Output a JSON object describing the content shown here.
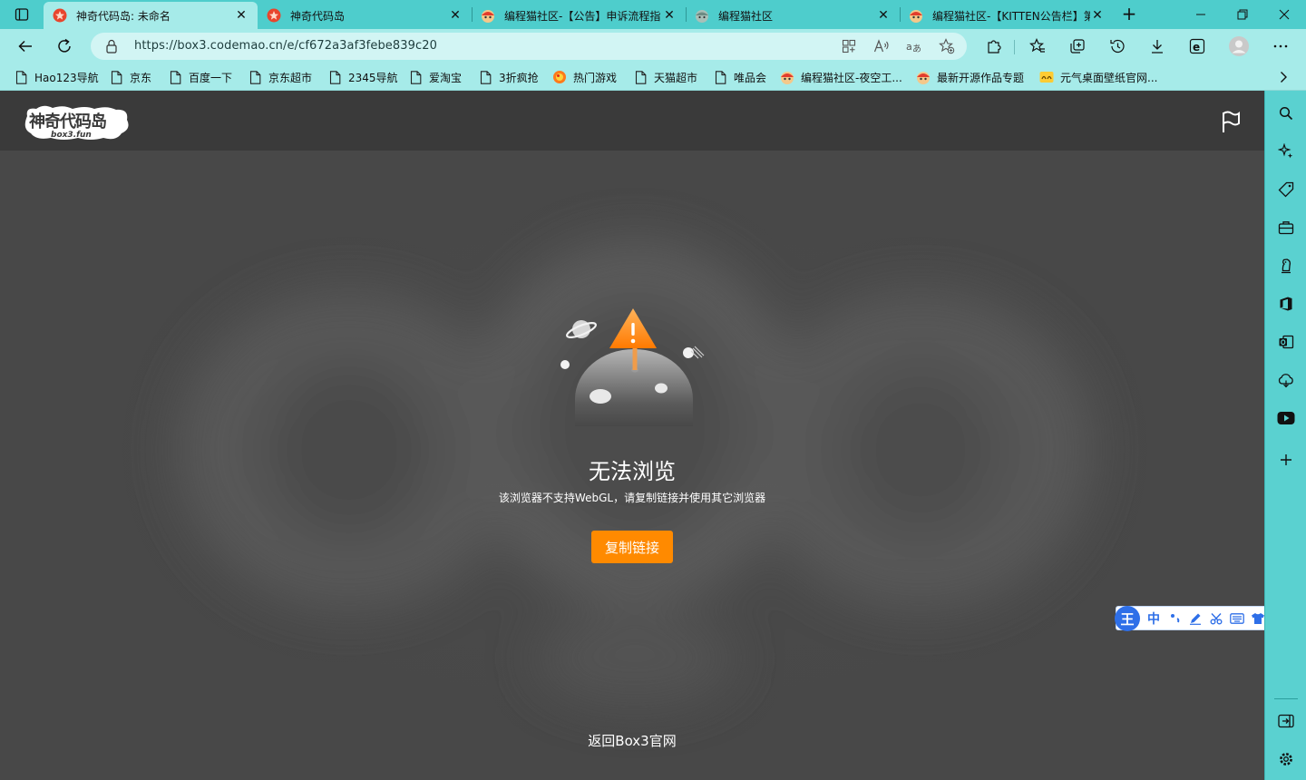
{
  "tabs": [
    {
      "title": "神奇代码岛: 未命名",
      "active": true
    },
    {
      "title": "神奇代码岛",
      "active": false
    },
    {
      "title": "编程猫社区-【公告】申诉流程指",
      "active": false
    },
    {
      "title": "编程猫社区",
      "active": false
    },
    {
      "title": "编程猫社区-【KITTEN公告栏】第",
      "active": false
    }
  ],
  "address": {
    "url": "https://box3.codemao.cn/e/cf672a3af3febe839c20"
  },
  "bookmarks": [
    {
      "label": "Hao123导航",
      "icon": "page-icon"
    },
    {
      "label": "京东",
      "icon": "page-icon"
    },
    {
      "label": "百度一下",
      "icon": "page-icon"
    },
    {
      "label": "京东超市",
      "icon": "page-icon"
    },
    {
      "label": "2345导航",
      "icon": "page-icon"
    },
    {
      "label": "爱淘宝",
      "icon": "page-icon"
    },
    {
      "label": "3折疯抢",
      "icon": "page-icon"
    },
    {
      "label": "热门游戏",
      "icon": "game-icon"
    },
    {
      "label": "天猫超市",
      "icon": "page-icon"
    },
    {
      "label": "唯品会",
      "icon": "page-icon"
    },
    {
      "label": "编程猫社区-夜空工...",
      "icon": "codemao-icon"
    },
    {
      "label": "最新开源作品专题",
      "icon": "codemao-icon"
    },
    {
      "label": "元气桌面壁纸官网...",
      "icon": "yuanqi-icon"
    }
  ],
  "page": {
    "error_title": "无法浏览",
    "error_desc": "该浏览器不支持WebGL，请复制链接并使用其它浏览器",
    "copy_button": "复制链接",
    "back_link": "返回Box3官网"
  },
  "ime": {
    "logo": "王",
    "mode": "中"
  },
  "colors": {
    "accent": "#ff8a00",
    "chrome": "#5ad1d0",
    "toolbar": "#a6ebe9",
    "content_bg": "#484848",
    "header_bg": "#3a3a3a"
  }
}
